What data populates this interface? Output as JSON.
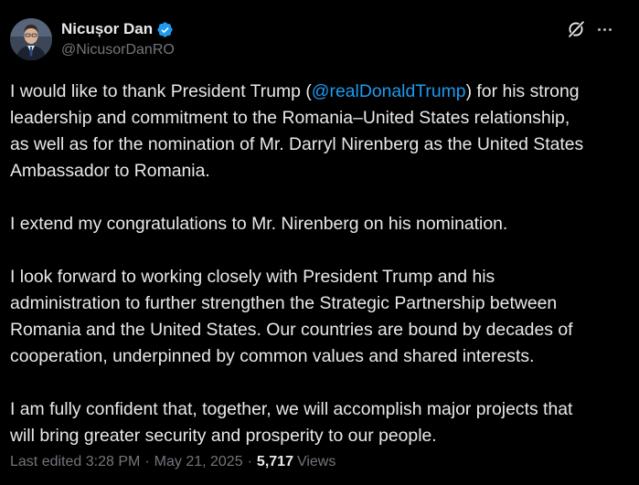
{
  "author": {
    "display_name": "Nicușor Dan",
    "handle": "@NicusorDanRO",
    "verified_icon": "verified-badge-icon",
    "verified_color": "#1d9bf0"
  },
  "actions": {
    "grok_icon": "grok-icon",
    "more_icon": "more-options-icon"
  },
  "post": {
    "p1_before": "I would like to thank President Trump (",
    "p1_mention": "@realDonaldTrump",
    "p1_after_line1": ") for his strong",
    "p1_line2": "leadership and commitment to the Romania–United States relationship,",
    "p1_line3": "as well as for the nomination of Mr. Darryl Nirenberg as the United States",
    "p1_line4": "Ambassador to Romania.",
    "p2": "I extend my congratulations to Mr. Nirenberg on his nomination.",
    "p3_line1": "I look forward to working closely with President Trump and his",
    "p3_line2": "administration to further strengthen the Strategic Partnership between",
    "p3_line3": "Romania and the United States. Our countries are bound by decades of",
    "p3_line4": "cooperation, underpinned by common values and shared interests.",
    "p4_line1": "I am fully confident that, together, we will accomplish major projects that",
    "p4_line2": "will bring greater security and prosperity to our people."
  },
  "meta": {
    "edited_label": "Last edited 3:28 PM",
    "separator": "·",
    "date": "May 21, 2025",
    "views_count": "5,717",
    "views_label": "Views"
  },
  "colors": {
    "background": "#000000",
    "text_primary": "#e7e9ea",
    "text_secondary": "#71767b",
    "accent": "#1d9bf0"
  }
}
